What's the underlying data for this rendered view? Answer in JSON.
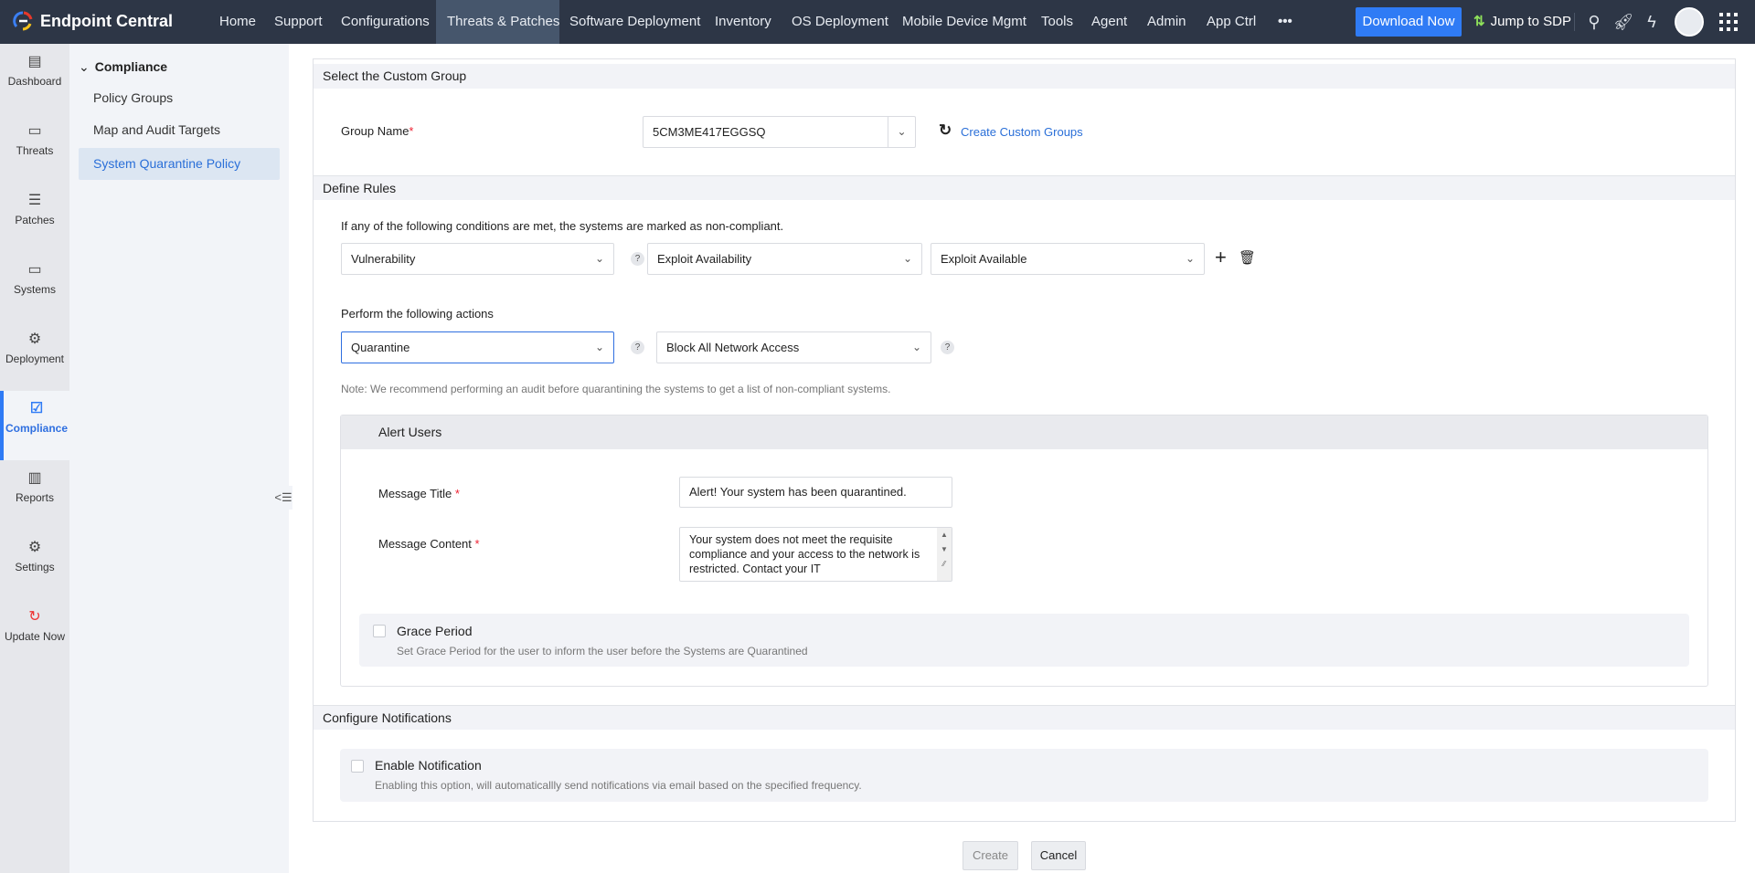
{
  "app": {
    "title": "Endpoint Central"
  },
  "topnav": {
    "items": [
      "Home",
      "Support",
      "Configurations",
      "Threats & Patches",
      "Software Deployment",
      "Inventory",
      "OS Deployment",
      "Mobile Device Mgmt",
      "Tools",
      "Agent",
      "Admin",
      "App Ctrl"
    ],
    "more": "•••",
    "active": "Threats & Patches",
    "download": "Download Now",
    "jump": "Jump to SDP"
  },
  "iconbar": {
    "items": [
      "Dashboard",
      "Threats",
      "Patches",
      "Systems",
      "Deployment",
      "Compliance",
      "Reports",
      "Settings",
      "Update Now"
    ],
    "active": "Compliance"
  },
  "subbar": {
    "header": "Compliance",
    "items": [
      "Policy Groups",
      "Map and Audit Targets",
      "System Quarantine Policy"
    ],
    "active": "System Quarantine Policy"
  },
  "custom_group": {
    "header": "Select the Custom Group",
    "label": "Group Name",
    "required": "*",
    "value": "5CM3ME417EGGSQ",
    "create_link": "Create Custom Groups"
  },
  "rules": {
    "header": "Define Rules",
    "condition_text": "If any of the following conditions are met, the systems are marked as non-compliant.",
    "condition": [
      "Vulnerability",
      "Exploit Availability",
      "Exploit Available"
    ],
    "actions_text": "Perform the following actions",
    "action": "Quarantine",
    "action_detail": "Block All Network Access",
    "help": "?",
    "note": "Note: We recommend performing an audit before quarantining the systems to get a list of non-compliant systems."
  },
  "alert": {
    "header": "Alert Users",
    "title_label": "Message Title",
    "title_value": "Alert! Your system has been quarantined.",
    "content_label": "Message Content",
    "content_value": "Your system does not meet the requisite compliance and your access to the network is restricted. Contact your IT",
    "grace_title": "Grace Period",
    "grace_desc": "Set Grace Period for the user to inform the user before the Systems are Quarantined"
  },
  "notifications": {
    "header": "Configure Notifications",
    "enable_title": "Enable Notification",
    "enable_desc": "Enabling this option, will automaticallly send notifications via email based on the specified frequency."
  },
  "buttons": {
    "create": "Create",
    "cancel": "Cancel"
  },
  "colors": {
    "topbar": "#2d3646",
    "accent": "#2f7bf5",
    "link": "#2a6fd8"
  }
}
